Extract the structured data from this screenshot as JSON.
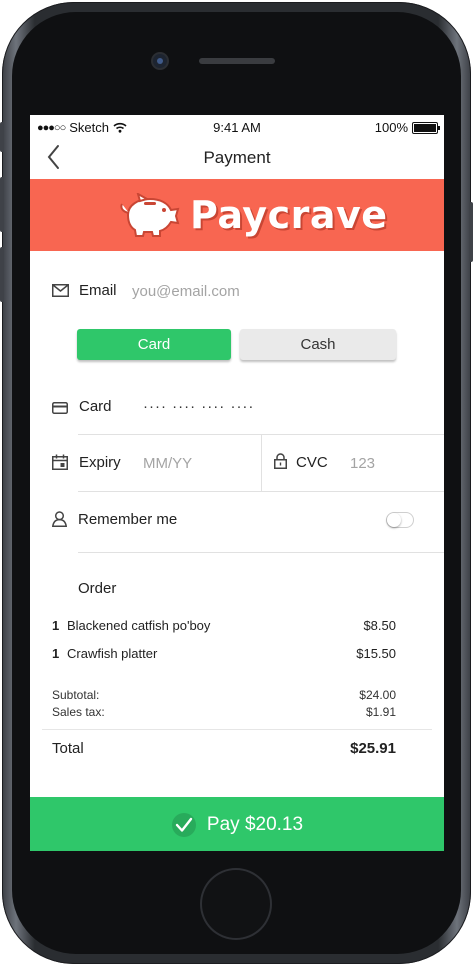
{
  "status_bar": {
    "carrier": "Sketch",
    "time": "9:41 AM",
    "battery": "100%"
  },
  "nav": {
    "title": "Payment"
  },
  "brand": {
    "name": "Paycrave",
    "color": "#f86651",
    "icon": "piggy-bank-icon"
  },
  "email": {
    "label": "Email",
    "placeholder": "you@email.com",
    "icon": "envelope-icon"
  },
  "payment_method": {
    "options": [
      "Card",
      "Cash"
    ],
    "selected": "Card",
    "selected_color": "#2fc76a"
  },
  "card": {
    "label": "Card",
    "placeholder": "···· ···· ···· ····",
    "icon": "credit-card-icon"
  },
  "expiry": {
    "label": "Expiry",
    "placeholder": "MM/YY",
    "icon": "calendar-icon"
  },
  "cvc": {
    "label": "CVC",
    "placeholder": "123",
    "icon": "lock-icon"
  },
  "remember": {
    "label": "Remember me",
    "icon": "user-icon",
    "enabled": false
  },
  "order": {
    "title": "Order",
    "items": [
      {
        "qty": "1",
        "name": "Blackened catfish po'boy",
        "price": "$8.50"
      },
      {
        "qty": "1",
        "name": "Crawfish platter",
        "price": "$15.50"
      }
    ],
    "subtotal_label": "Subtotal:",
    "subtotal": "$24.00",
    "tax_label": "Sales tax:",
    "tax": "$1.91",
    "total_label": "Total",
    "total": "$25.91"
  },
  "pay_button": {
    "label": "Pay $20.13",
    "icon": "checkmark-icon",
    "color": "#2fc76a"
  }
}
